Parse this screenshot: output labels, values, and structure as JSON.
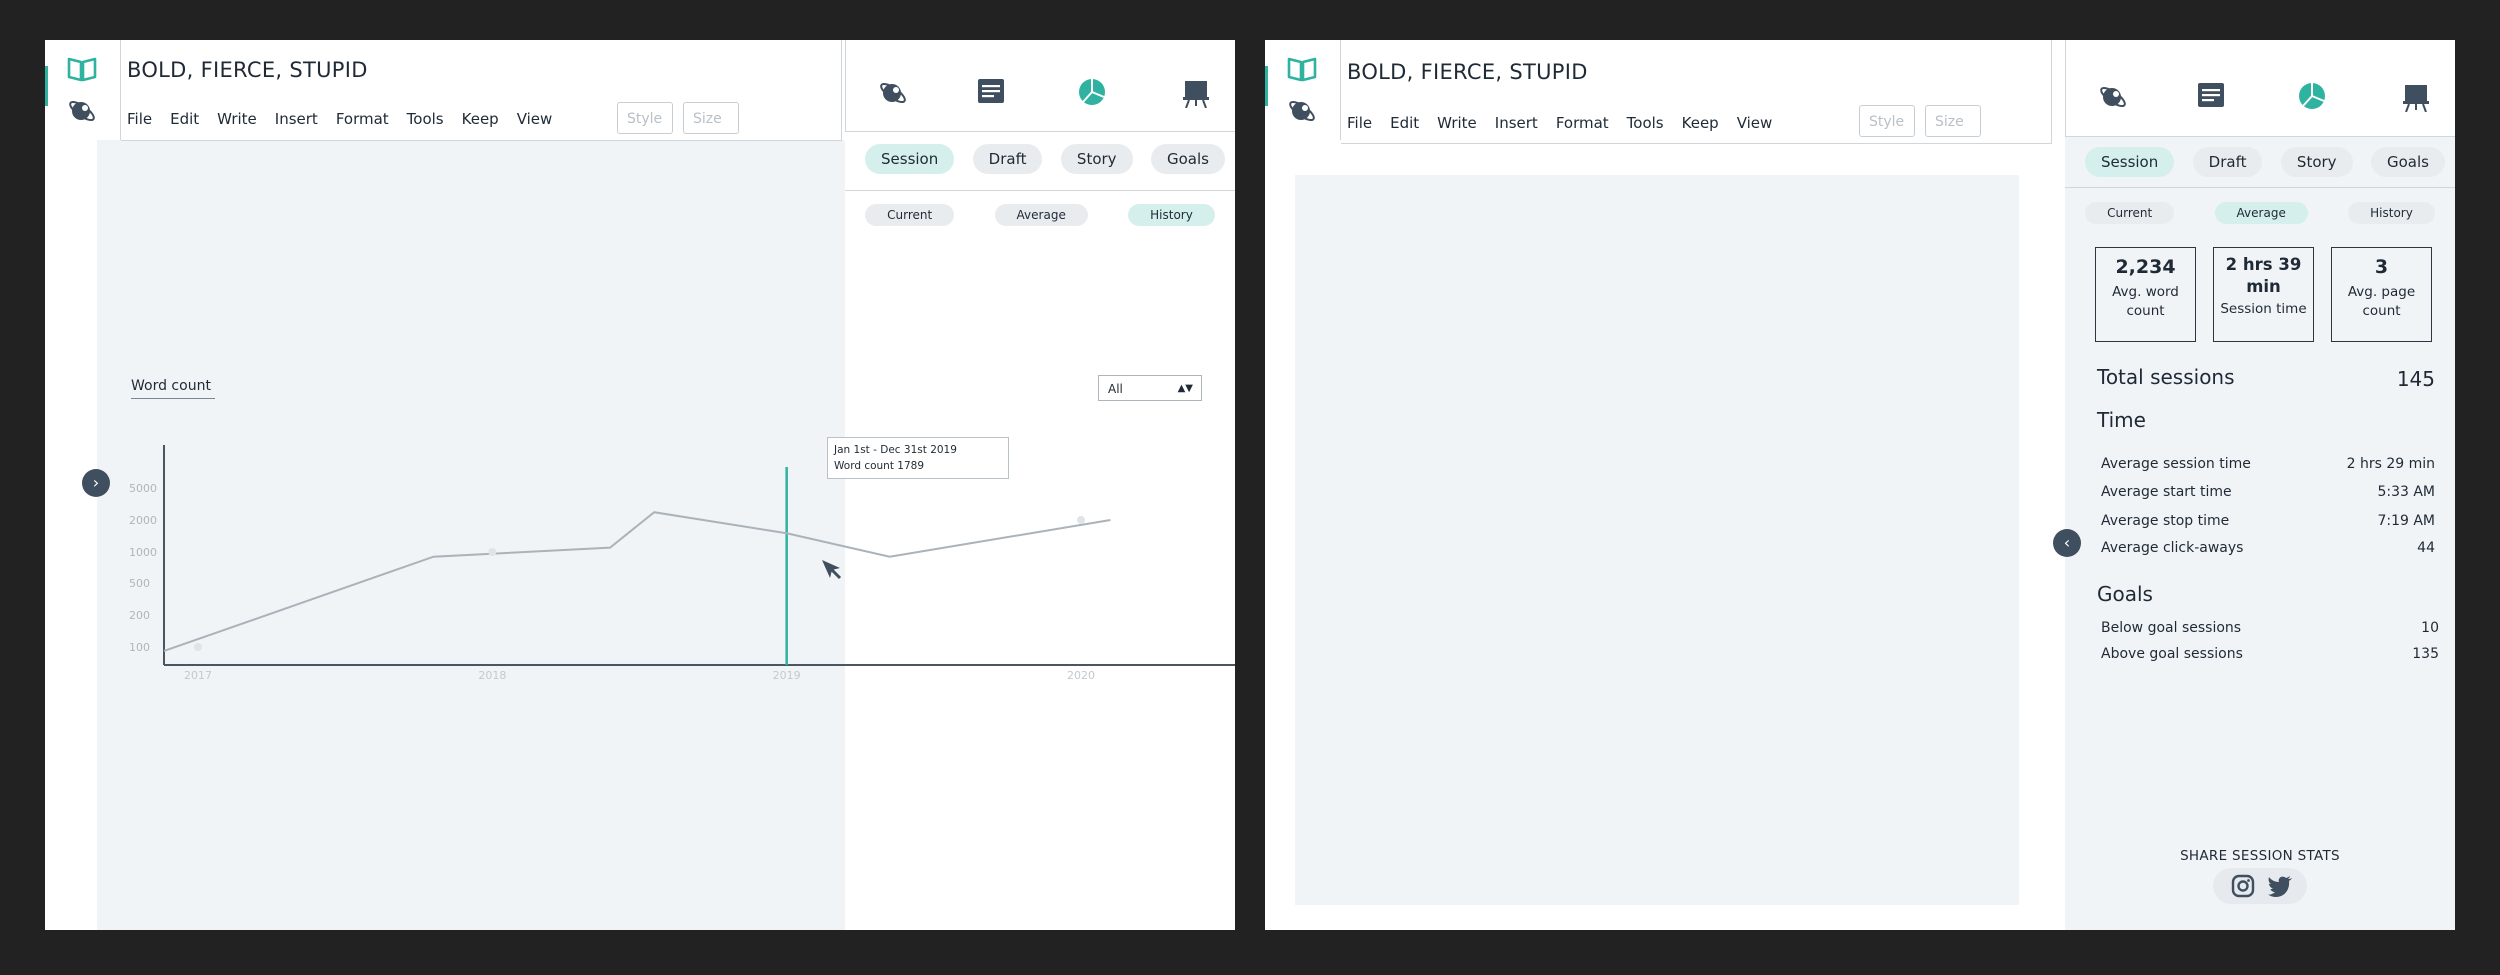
{
  "app": {
    "doc_title": "BOLD, FIERCE, STUPID",
    "menu": [
      "File",
      "Edit",
      "Write",
      "Insert",
      "Format",
      "Tools",
      "Keep",
      "View"
    ],
    "style_placeholder": "Style",
    "size_placeholder": "Size"
  },
  "panel": {
    "tabs": [
      {
        "label": "Session",
        "active": true
      },
      {
        "label": "Draft",
        "active": false
      },
      {
        "label": "Story",
        "active": false
      },
      {
        "label": "Goals",
        "active": false
      }
    ],
    "icons": [
      "planet-icon",
      "document-icon",
      "pie-chart-icon",
      "presentation-board-icon"
    ]
  },
  "screen1": {
    "subtabs": [
      {
        "label": "Current",
        "active": false
      },
      {
        "label": "Average",
        "active": false
      },
      {
        "label": "History",
        "active": true
      }
    ],
    "chart_label": "Word count",
    "filter_value": "All",
    "tooltip": {
      "line1": "Jan 1st - Dec 31st 2019",
      "line2": "Word count 1789"
    },
    "expand_icon": "chevron-right-icon"
  },
  "screen2": {
    "subtabs": [
      {
        "label": "Current",
        "active": false
      },
      {
        "label": "Average",
        "active": true
      },
      {
        "label": "History",
        "active": false
      }
    ],
    "boxes": [
      {
        "value": "2,234",
        "label": "Avg. word count"
      },
      {
        "value": "2 hrs 39 min",
        "label": "Session time"
      },
      {
        "value": "3",
        "label": "Avg. page count"
      }
    ],
    "total_sessions_label": "Total sessions",
    "total_sessions_value": "145",
    "time_title": "Time",
    "time_rows": [
      {
        "label": "Average session time",
        "value": "2 hrs 29 min"
      },
      {
        "label": "Average start time",
        "value": "5:33 AM"
      },
      {
        "label": "Average stop time",
        "value": "7:19 AM"
      },
      {
        "label": "Average click-aways",
        "value": "44"
      }
    ],
    "goals_title": "Goals",
    "goals_rows": [
      {
        "label": "Below goal sessions",
        "value": "10"
      },
      {
        "label": "Above goal sessions",
        "value": "135"
      }
    ],
    "share_label": "SHARE SESSION STATS",
    "share_icons": [
      "instagram-icon",
      "twitter-icon"
    ],
    "collapse_icon": "chevron-left-icon"
  },
  "chart_data": {
    "type": "line",
    "ylabel": "Word count",
    "x_ticks": [
      "2017",
      "2018",
      "2019",
      "2020"
    ],
    "y_ticks": [
      "100",
      "200",
      "500",
      "1000",
      "2000",
      "5000"
    ],
    "y_scale": "log",
    "series": [
      {
        "points": [
          {
            "x": 2016.8,
            "y": 60
          },
          {
            "x": 2017.8,
            "y": 900
          },
          {
            "x": 2018.4,
            "y": 1100
          },
          {
            "x": 2018.55,
            "y": 2500
          },
          {
            "x": 2019.0,
            "y": 1500
          },
          {
            "x": 2019.35,
            "y": 900
          },
          {
            "x": 2020.1,
            "y": 2000
          }
        ]
      }
    ],
    "markers": [
      {
        "x": 2017.0,
        "y": 100
      },
      {
        "x": 2018.0,
        "y": 1000
      },
      {
        "x": 2020.0,
        "y": 2000
      }
    ],
    "highlight_x": 2019.0,
    "grid": false
  },
  "colors": {
    "accent": "#2fb3a0",
    "accent_light": "#d5f0ec",
    "dark": "#3f4f5f",
    "canvas": "#f1f4f7"
  }
}
